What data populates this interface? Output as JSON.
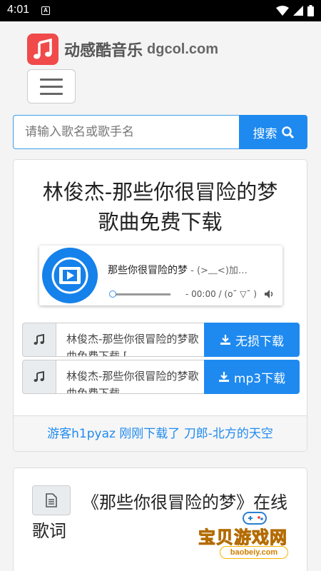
{
  "status_bar": {
    "time": "4:01",
    "notification_glyph": "A"
  },
  "header": {
    "site_name": "动感酷音乐",
    "domain": "dgcol.com"
  },
  "search": {
    "placeholder": "请输入歌名或歌手名",
    "button_label": "搜索"
  },
  "song_card": {
    "title_line1": "林俊杰-那些你很冒险的梦",
    "title_line2": "歌曲免费下载",
    "player": {
      "song": "那些你很冒险的梦",
      "subtitle": " - (>﹏<)加…",
      "time": "- 00:00 / (o˘ ▽˘ )"
    },
    "downloads": [
      {
        "field_text": "林俊杰-那些你很冒险的梦歌曲免费下载 [",
        "button_label": "无损下载"
      },
      {
        "field_text": "林俊杰-那些你很冒险的梦歌曲免费下载",
        "button_label": "mp3下载"
      }
    ],
    "notice": "游客h1pyaz 刚刚下载了 刀郎-北方的天空"
  },
  "lyrics_card": {
    "title": "《那些你很冒险的梦》在线歌词"
  },
  "watermark": {
    "text": "宝贝游戏网",
    "url": "baobeiy.com"
  },
  "colors": {
    "accent": "#1e8af0",
    "logo": "#f04a4a",
    "status_bar": "#000000"
  },
  "icons": [
    "music-note-icon",
    "hamburger-icon",
    "search-icon",
    "play-icon",
    "volume-icon",
    "download-icon",
    "document-icon",
    "wifi-icon",
    "signal-icon",
    "battery-icon"
  ]
}
